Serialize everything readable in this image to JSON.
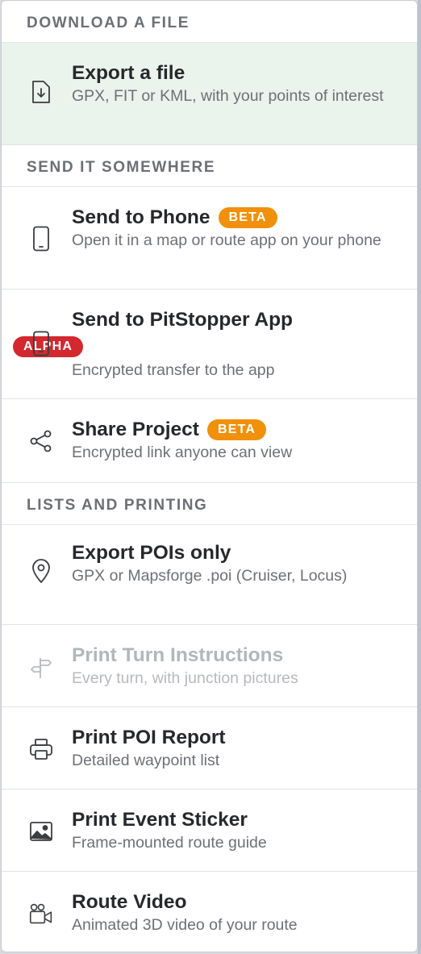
{
  "sections": [
    {
      "header": "DOWNLOAD A FILE",
      "items": [
        {
          "title": "Export a file",
          "description": "GPX, FIT or KML, with your points of interest",
          "icon": "file-download-icon"
        }
      ]
    },
    {
      "header": "SEND IT SOMEWHERE",
      "items": [
        {
          "title": "Send to Phone",
          "badge": "BETA",
          "description": "Open it in a map or route app on your phone",
          "icon": "phone-icon"
        },
        {
          "title": "Send to PitStopper App",
          "badge": "ALPHA",
          "description": "Encrypted transfer to the app",
          "icon": "phone-icon"
        },
        {
          "title": "Share Project",
          "badge": "BETA",
          "description": "Encrypted link anyone can view",
          "icon": "share-icon"
        }
      ]
    },
    {
      "header": "LISTS AND PRINTING",
      "items": [
        {
          "title": "Export POIs only",
          "description": "GPX or Mapsforge .poi (Cruiser, Locus)",
          "icon": "map-pin-icon"
        },
        {
          "title": "Print Turn Instructions",
          "description": "Every turn, with junction pictures",
          "icon": "signpost-icon",
          "disabled": true
        },
        {
          "title": "Print POI Report",
          "description": "Detailed waypoint list",
          "icon": "printer-icon"
        },
        {
          "title": "Print Event Sticker",
          "description": "Frame-mounted route guide",
          "icon": "image-icon"
        },
        {
          "title": "Route Video",
          "description": "Animated 3D video of your route",
          "icon": "video-camera-icon"
        }
      ]
    }
  ],
  "colors": {
    "beta_badge": "#f0900b",
    "alpha_badge": "#d2282e",
    "selected_row": "#eaf3ec"
  }
}
